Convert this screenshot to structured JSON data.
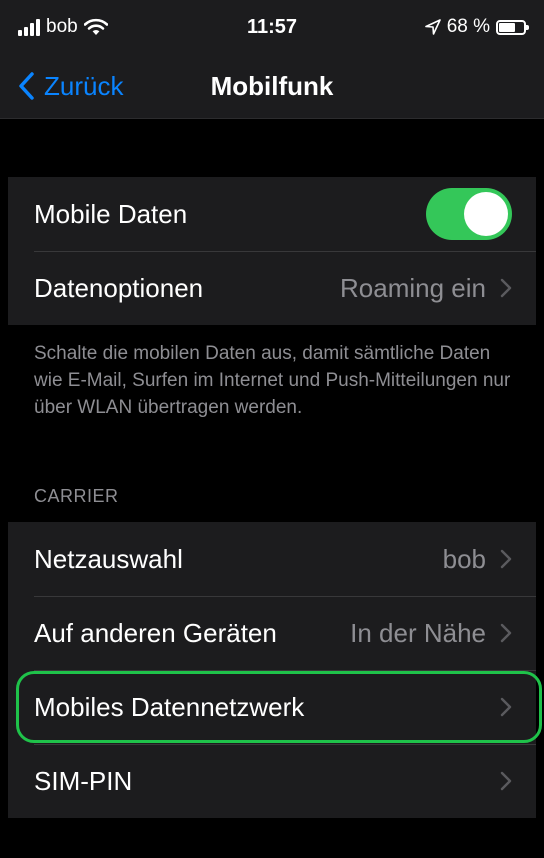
{
  "status_bar": {
    "carrier": "bob",
    "time": "11:57",
    "battery": "68 %",
    "battery_level": 0.68,
    "icons": [
      "signal-icon",
      "wifi-icon",
      "location-arrow-icon",
      "battery-icon"
    ]
  },
  "nav": {
    "back_label": "Zurück",
    "title": "Mobilfunk"
  },
  "mobile_data_group": {
    "mobile_data": {
      "label": "Mobile Daten",
      "enabled": true
    },
    "data_options": {
      "label": "Datenoptionen",
      "value": "Roaming ein"
    }
  },
  "footnote": "Schalte die mobilen Daten aus, damit sämtliche Daten wie E-Mail, Surfen im Internet und Push-Mitteilungen nur über WLAN übertragen werden.",
  "carrier_section": {
    "header": "CARRIER",
    "items": [
      {
        "label": "Netzauswahl",
        "value": "bob"
      },
      {
        "label": "Auf anderen Geräten",
        "value": "In der Nähe"
      },
      {
        "label": "Mobiles Datennetzwerk",
        "value": ""
      },
      {
        "label": "SIM-PIN",
        "value": ""
      }
    ]
  },
  "colors": {
    "accent": "#0a84ff",
    "toggle_on": "#34c759",
    "highlight": "#1fc24a",
    "background": "#000000",
    "cell": "#1c1c1e",
    "secondary_text": "#8e8e93"
  }
}
